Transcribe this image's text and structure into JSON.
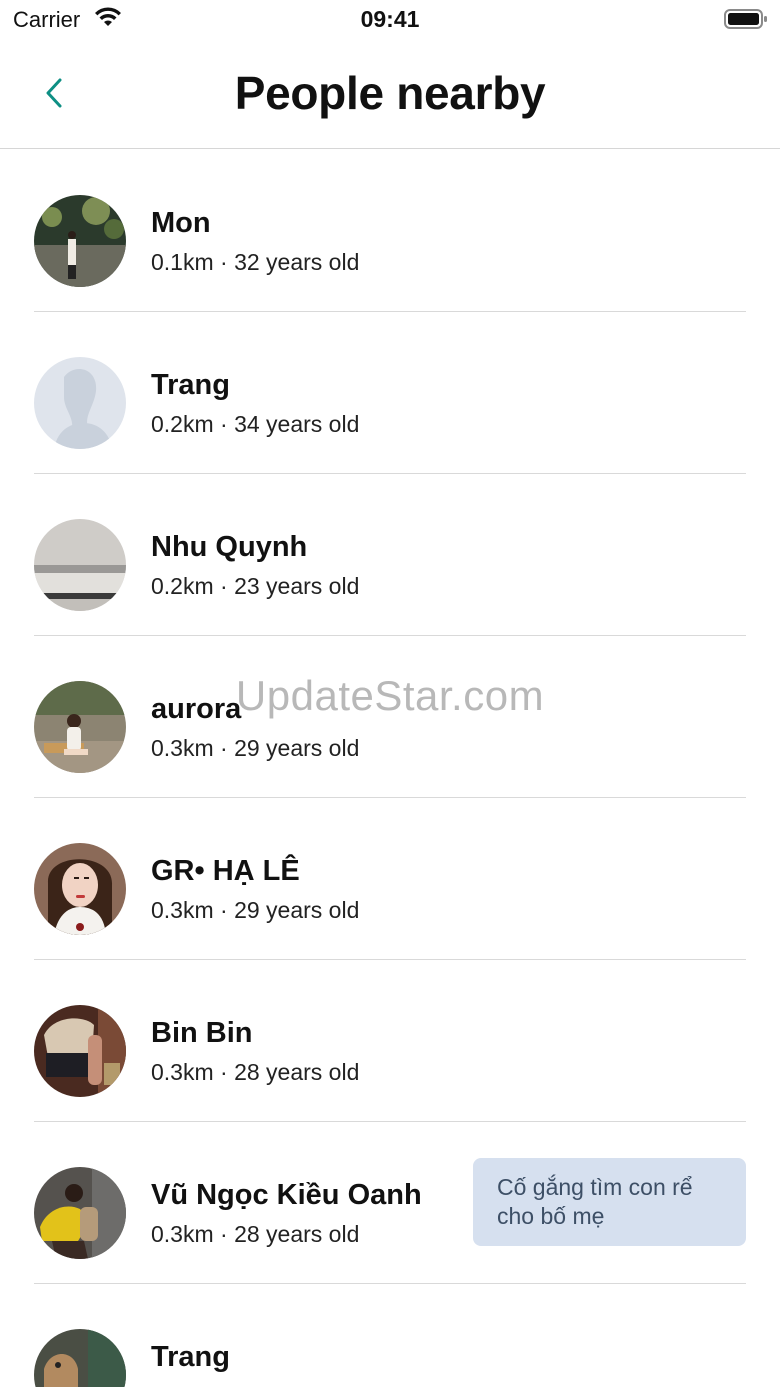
{
  "status_bar": {
    "carrier": "Carrier",
    "time": "09:41"
  },
  "nav": {
    "title": "People nearby",
    "back_icon": "chevron-left-icon",
    "accent_color": "#0e8f84"
  },
  "people": [
    {
      "name": "Mon",
      "distance": "0.1km",
      "age": "32 years old",
      "meta": "0.1km · 32 years old",
      "status": ""
    },
    {
      "name": "Trang",
      "distance": "0.2km",
      "age": "34 years old",
      "meta": "0.2km · 34 years old",
      "status": ""
    },
    {
      "name": "Nhu Quynh",
      "distance": "0.2km",
      "age": "23 years old",
      "meta": "0.2km · 23 years old",
      "status": ""
    },
    {
      "name": "aurora",
      "distance": "0.3km",
      "age": "29 years old",
      "meta": "0.3km · 29 years old",
      "status": ""
    },
    {
      "name": "GR• HẠ LÊ",
      "distance": "0.3km",
      "age": "29 years old",
      "meta": "0.3km · 29 years old",
      "status": ""
    },
    {
      "name": "Bin Bin",
      "distance": "0.3km",
      "age": "28 years old",
      "meta": "0.3km · 28 years old",
      "status": ""
    },
    {
      "name": "Vũ Ngọc Kiều Oanh",
      "distance": "0.3km",
      "age": "28 years old",
      "meta": "0.3km · 28 years old",
      "status": "Cố gắng tìm con rể cho bố mẹ"
    },
    {
      "name": "Trang",
      "distance": "",
      "age": "",
      "meta": "",
      "status": ""
    }
  ],
  "watermark": "UpdateStar.com"
}
